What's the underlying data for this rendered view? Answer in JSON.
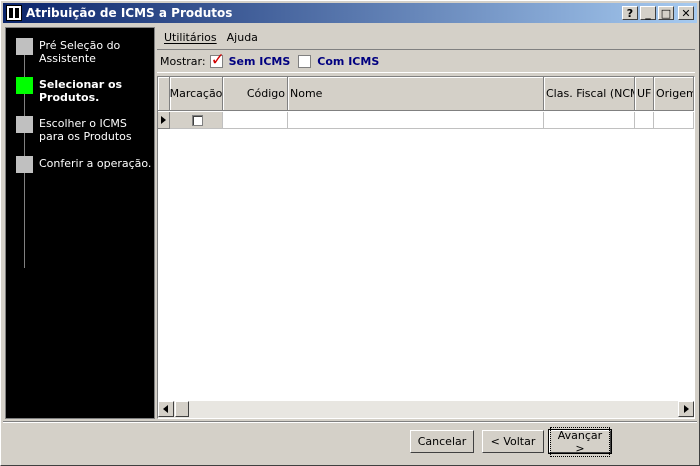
{
  "window": {
    "title": "Atribuição de ICMS a Produtos"
  },
  "titlebar_buttons": {
    "help": "?",
    "minimize": "_",
    "maximize": "□",
    "close": "✕"
  },
  "steps": [
    {
      "label": "Pré Seleção do Assistente",
      "active": false
    },
    {
      "label": "Selecionar os Produtos.",
      "active": true
    },
    {
      "label": "Escolher o ICMS para os Produtos",
      "active": false
    },
    {
      "label": "Conferir a operação.",
      "active": false
    }
  ],
  "menu": {
    "utilitarios": "Utilitários",
    "ajuda": "Ajuda"
  },
  "filter": {
    "label": "Mostrar:",
    "sem_icms": {
      "label": "Sem ICMS",
      "checked": true
    },
    "com_icms": {
      "label": "Com ICMS",
      "checked": false
    }
  },
  "grid": {
    "columns": [
      "Marcação",
      "Código",
      "Nome",
      "Clas. Fiscal (NCM)",
      "UF",
      "Origem"
    ]
  },
  "buttons": {
    "cancel": "Cancelar",
    "back": "< Voltar",
    "next": "Avançar >"
  },
  "colors": {
    "titlebar": "#0a246a",
    "active_step": "#00ff00",
    "option_text": "#000080",
    "check": "#d00000"
  }
}
